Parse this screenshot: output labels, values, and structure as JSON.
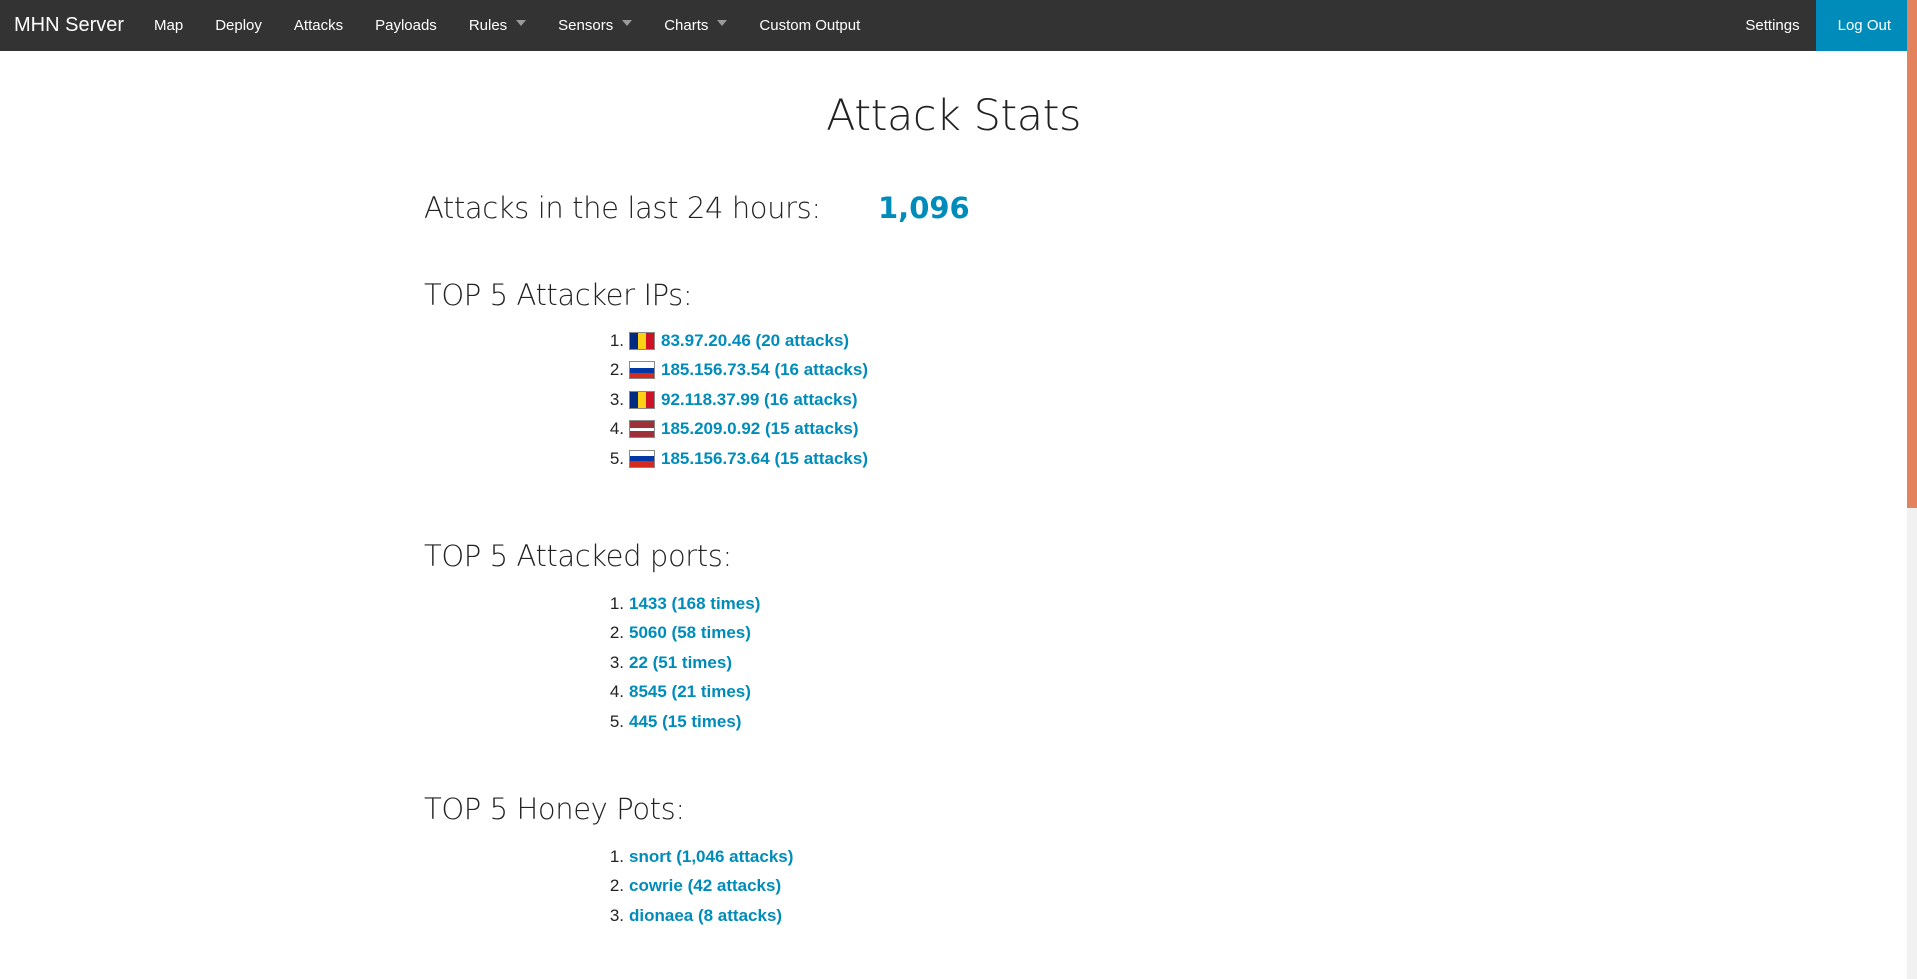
{
  "nav": {
    "brand": "MHN Server",
    "items": [
      {
        "label": "Map",
        "dropdown": false
      },
      {
        "label": "Deploy",
        "dropdown": false
      },
      {
        "label": "Attacks",
        "dropdown": false
      },
      {
        "label": "Payloads",
        "dropdown": false
      },
      {
        "label": "Rules",
        "dropdown": true
      },
      {
        "label": "Sensors",
        "dropdown": true
      },
      {
        "label": "Charts",
        "dropdown": true
      },
      {
        "label": "Custom Output",
        "dropdown": false
      }
    ],
    "settings": "Settings",
    "logout": "Log Out"
  },
  "page": {
    "title": "Attack Stats",
    "attacks_label": "Attacks in the last 24 hours:",
    "attacks_count": "1,096"
  },
  "top_ips": {
    "heading": "TOP 5 Attacker IPs:",
    "items": [
      {
        "rank": "1.",
        "text": "83.97.20.46 (20 attacks)",
        "flag": "romania-flag-icon",
        "flag_colors": [
          "#002b7f",
          "#fcd116",
          "#ce1126"
        ]
      },
      {
        "rank": "2.",
        "text": "185.156.73.54 (16 attacks)",
        "flag": "russia-flag-icon",
        "flag_colors": [
          "#ffffff",
          "#0039a6",
          "#d52b1e"
        ]
      },
      {
        "rank": "3.",
        "text": "92.118.37.99 (16 attacks)",
        "flag": "romania-flag-icon",
        "flag_colors": [
          "#002b7f",
          "#fcd116",
          "#ce1126"
        ]
      },
      {
        "rank": "4.",
        "text": "185.209.0.92 (15 attacks)",
        "flag": "latvia-flag-icon",
        "flag_colors": [
          "#9e3039",
          "#ffffff",
          "#9e3039"
        ]
      },
      {
        "rank": "5.",
        "text": "185.156.73.64 (15 attacks)",
        "flag": "russia-flag-icon",
        "flag_colors": [
          "#ffffff",
          "#0039a6",
          "#d52b1e"
        ]
      }
    ]
  },
  "top_ports": {
    "heading": "TOP 5 Attacked ports:",
    "items": [
      {
        "rank": "1.",
        "text": "1433 (168 times)"
      },
      {
        "rank": "2.",
        "text": "5060 (58 times)"
      },
      {
        "rank": "3.",
        "text": "22 (51 times)"
      },
      {
        "rank": "4.",
        "text": "8545 (21 times)"
      },
      {
        "rank": "5.",
        "text": "445 (15 times)"
      }
    ]
  },
  "top_honeypots": {
    "heading": "TOP 5 Honey Pots:",
    "items": [
      {
        "rank": "1.",
        "text": "snort (1,046 attacks)"
      },
      {
        "rank": "2.",
        "text": "cowrie (42 attacks)"
      },
      {
        "rank": "3.",
        "text": "dionaea (8 attacks)"
      }
    ]
  },
  "colors": {
    "navbar": "#333333",
    "accent": "#008cba",
    "scroll_thumb": "#e2835d"
  }
}
